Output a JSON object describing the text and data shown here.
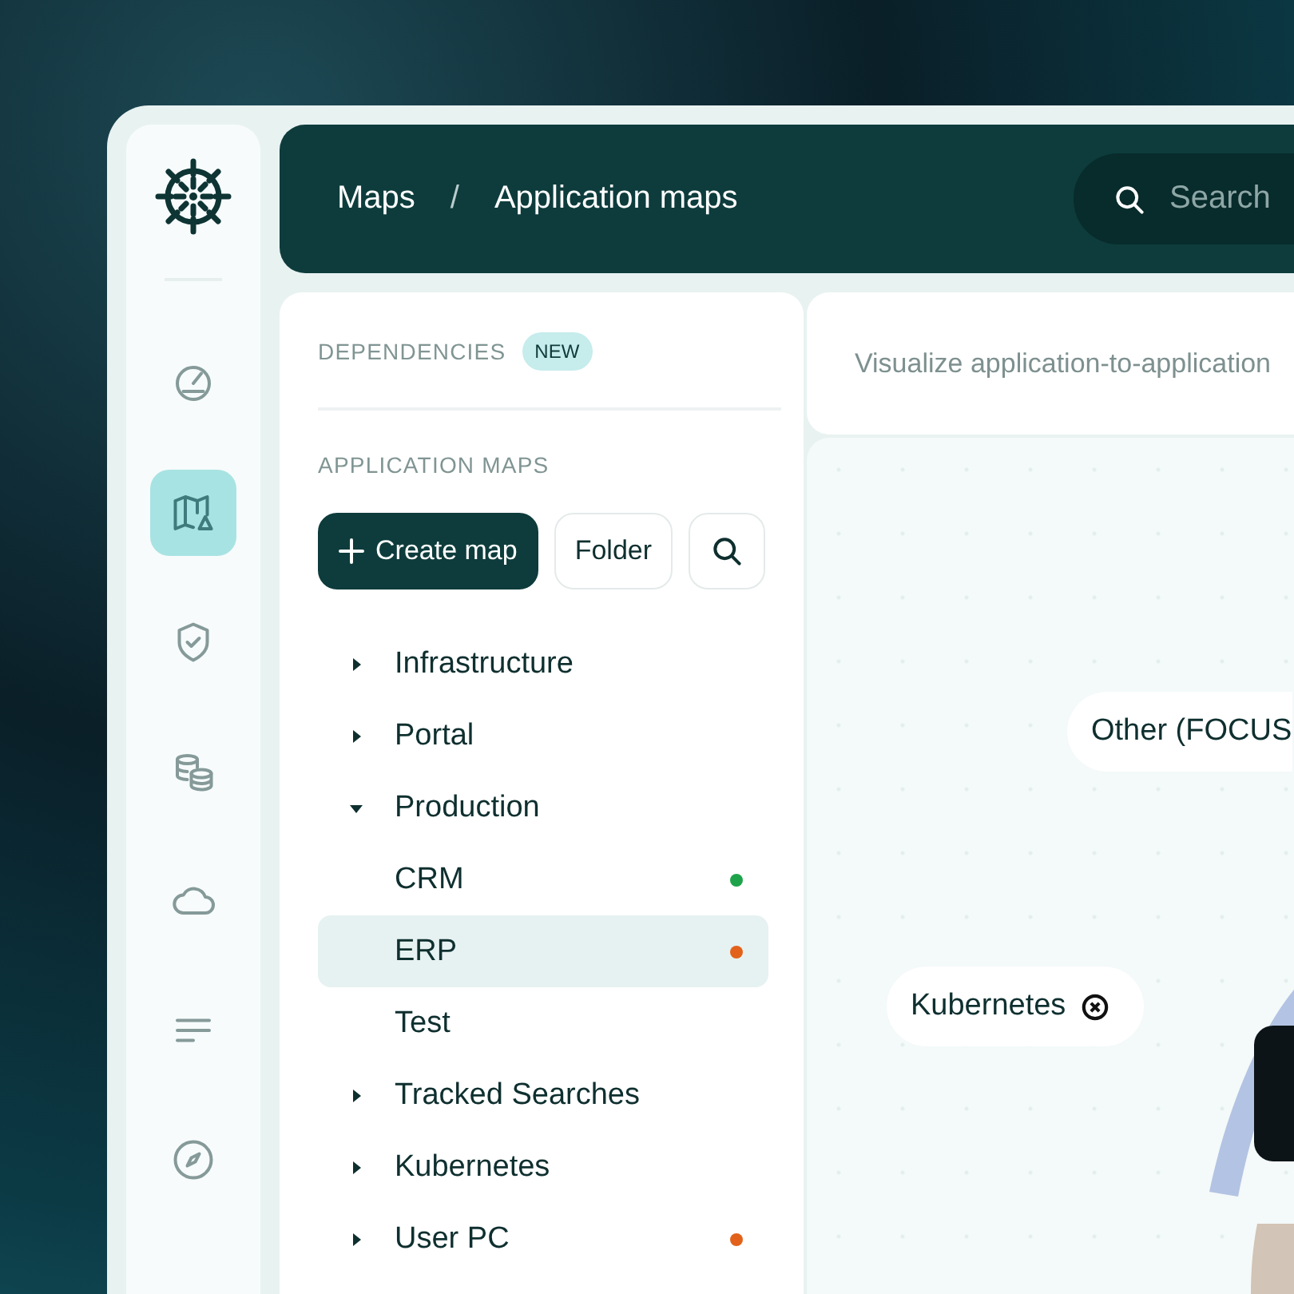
{
  "rail": {
    "items": [
      {
        "selected": false
      },
      {
        "selected": true
      },
      {
        "selected": false
      },
      {
        "selected": false
      },
      {
        "selected": false
      },
      {
        "selected": false
      },
      {
        "selected": false
      }
    ]
  },
  "header": {
    "breadcrumb": [
      "Maps",
      "/",
      "Application maps"
    ],
    "search": {
      "placeholder": "Search"
    }
  },
  "sidebar": {
    "dependencies": {
      "label": "DEPENDENCIES",
      "badge": "NEW"
    },
    "section_title": "APPLICATION MAPS",
    "buttons": {
      "create": "Create map",
      "folder": "Folder"
    },
    "tree": [
      {
        "label": "Infrastructure",
        "expanded": false,
        "selected": false
      },
      {
        "label": "Portal",
        "expanded": false,
        "selected": false
      },
      {
        "label": "Production",
        "expanded": true,
        "selected": false,
        "children": [
          {
            "label": "CRM",
            "selected": false,
            "color": "#1fa34a"
          },
          {
            "label": "ERP",
            "selected": true,
            "color": "#e2621b"
          },
          {
            "label": "Test",
            "selected": false
          }
        ]
      },
      {
        "label": "Tracked Searches",
        "expanded": false,
        "selected": false
      },
      {
        "label": "Kubernetes",
        "expanded": false,
        "selected": false
      },
      {
        "label": "User PC",
        "expanded": false,
        "selected": false,
        "color": "#e2621b"
      }
    ]
  },
  "main": {
    "description": "Visualize application-to-application",
    "nodes": [
      {
        "label": "Other (FOCUS",
        "removable": false
      },
      {
        "label": "Kubernetes",
        "removable": true
      }
    ]
  }
}
